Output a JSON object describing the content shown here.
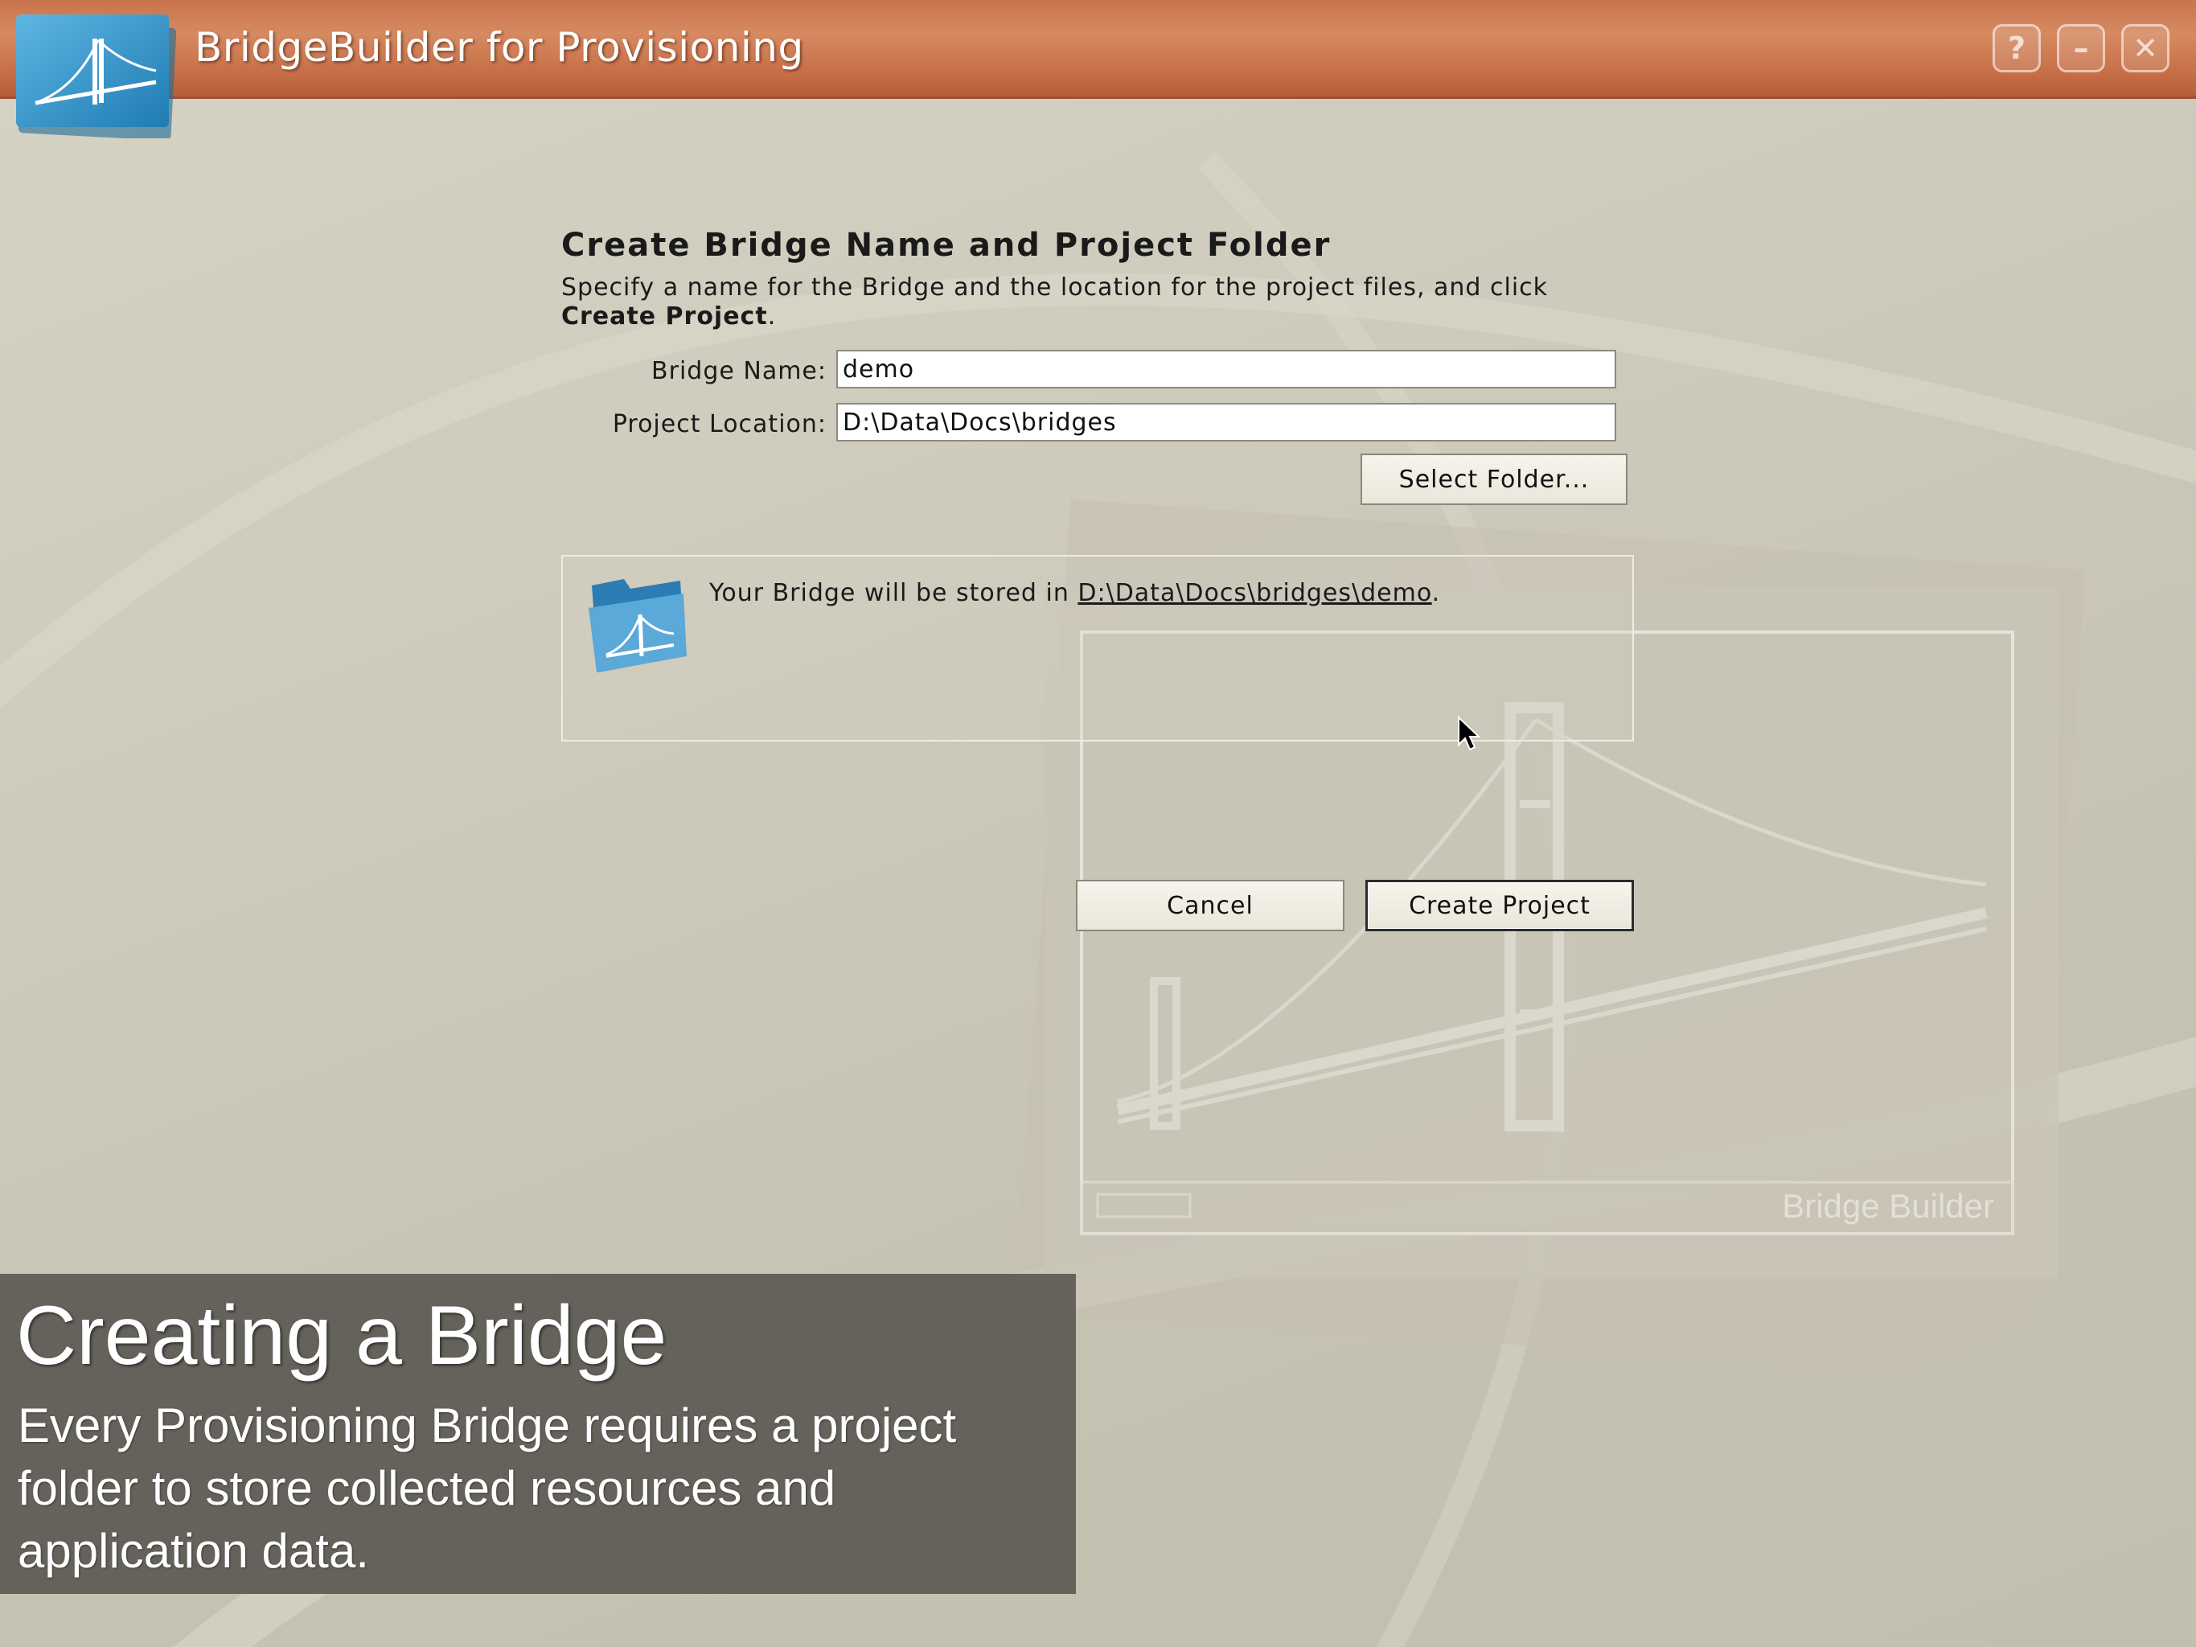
{
  "window": {
    "title": "BridgeBuilder for Provisioning",
    "help_label": "?",
    "minimize_label": "–",
    "close_label": "✕"
  },
  "form": {
    "heading": "Create Bridge Name and Project Folder",
    "instructions_prefix": "Specify a name for the Bridge and the location for the project files, and click ",
    "instructions_bold": "Create Project",
    "instructions_suffix": ".",
    "bridge_name_label": "Bridge Name:",
    "bridge_name_value": "demo",
    "project_location_label": "Project Location:",
    "project_location_value": "D:\\Data\\Docs\\bridges",
    "select_folder_label": "Select Folder..."
  },
  "info": {
    "prefix": "Your Bridge will be stored in ",
    "path": "D:\\Data\\Docs\\bridges\\demo",
    "suffix": "."
  },
  "actions": {
    "cancel_label": "Cancel",
    "create_label": "Create Project"
  },
  "background": {
    "watermark": "Bridge Builder"
  },
  "caption": {
    "title": "Creating a Bridge",
    "body": "Every Provisioning Bridge requires a project folder to store collected resources and application data."
  },
  "colors": {
    "titlebar": "#c7734b",
    "background": "#cfcbbc",
    "caption_bg": "#605e56"
  }
}
